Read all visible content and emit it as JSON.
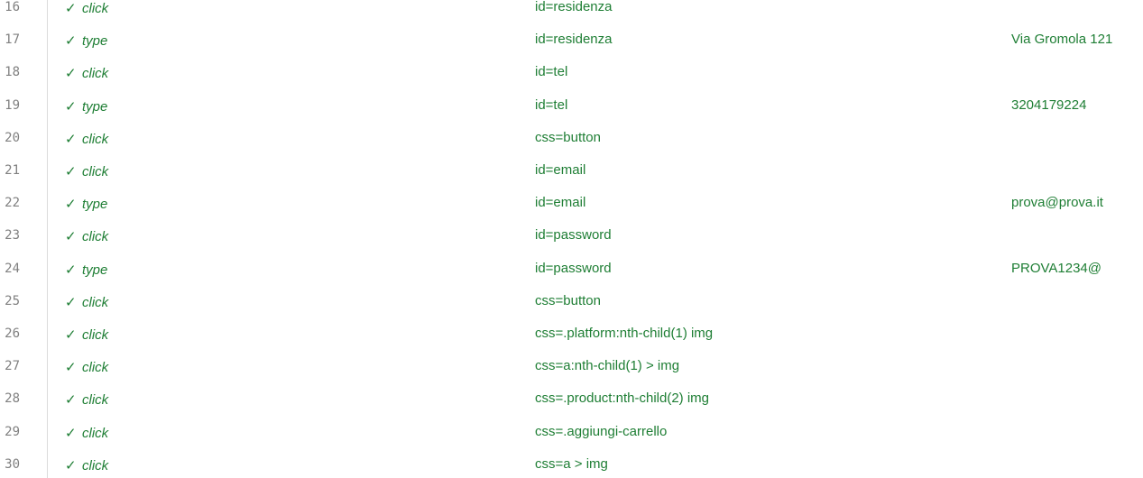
{
  "rows": [
    {
      "line": "16",
      "status_icon": "check-icon",
      "status": "✓",
      "command": "click",
      "target": "id=residenza",
      "value": ""
    },
    {
      "line": "17",
      "status_icon": "check-icon",
      "status": "✓",
      "command": "type",
      "target": "id=residenza",
      "value": "Via Gromola 121"
    },
    {
      "line": "18",
      "status_icon": "check-icon",
      "status": "✓",
      "command": "click",
      "target": "id=tel",
      "value": ""
    },
    {
      "line": "19",
      "status_icon": "check-icon",
      "status": "✓",
      "command": "type",
      "target": "id=tel",
      "value": "3204179224"
    },
    {
      "line": "20",
      "status_icon": "check-icon",
      "status": "✓",
      "command": "click",
      "target": "css=button",
      "value": ""
    },
    {
      "line": "21",
      "status_icon": "check-icon",
      "status": "✓",
      "command": "click",
      "target": "id=email",
      "value": ""
    },
    {
      "line": "22",
      "status_icon": "check-icon",
      "status": "✓",
      "command": "type",
      "target": "id=email",
      "value": "prova@prova.it"
    },
    {
      "line": "23",
      "status_icon": "check-icon",
      "status": "✓",
      "command": "click",
      "target": "id=password",
      "value": ""
    },
    {
      "line": "24",
      "status_icon": "check-icon",
      "status": "✓",
      "command": "type",
      "target": "id=password",
      "value": "PROVA1234@"
    },
    {
      "line": "25",
      "status_icon": "check-icon",
      "status": "✓",
      "command": "click",
      "target": "css=button",
      "value": ""
    },
    {
      "line": "26",
      "status_icon": "check-icon",
      "status": "✓",
      "command": "click",
      "target": "css=.platform:nth-child(1) img",
      "value": ""
    },
    {
      "line": "27",
      "status_icon": "check-icon",
      "status": "✓",
      "command": "click",
      "target": "css=a:nth-child(1) > img",
      "value": ""
    },
    {
      "line": "28",
      "status_icon": "check-icon",
      "status": "✓",
      "command": "click",
      "target": "css=.product:nth-child(2) img",
      "value": ""
    },
    {
      "line": "29",
      "status_icon": "check-icon",
      "status": "✓",
      "command": "click",
      "target": "css=.aggiungi-carrello",
      "value": ""
    },
    {
      "line": "30",
      "status_icon": "check-icon",
      "status": "✓",
      "command": "click",
      "target": "css=a > img",
      "value": ""
    }
  ],
  "colors": {
    "passed_text": "#1e7e34",
    "line_number": "#808080",
    "gutter_border": "#dcdcdc"
  }
}
